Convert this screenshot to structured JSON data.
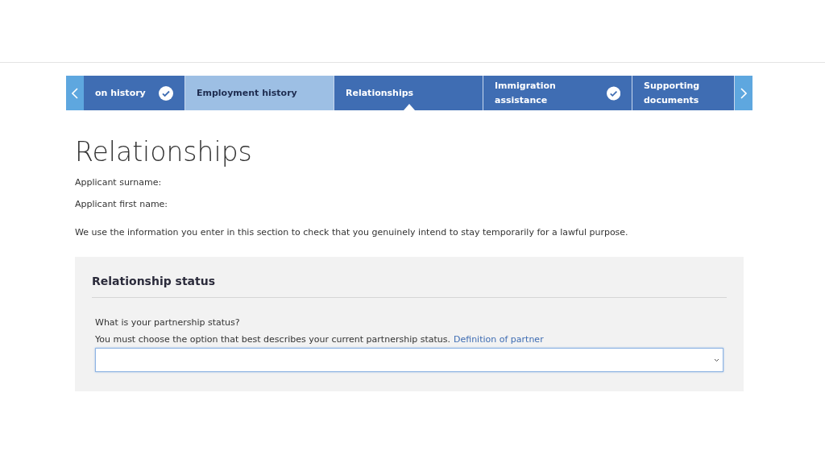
{
  "steps": [
    {
      "label": "on history",
      "completed": true,
      "highlighted": false,
      "selected": false
    },
    {
      "label": "Employment history",
      "completed": false,
      "highlighted": true,
      "selected": false
    },
    {
      "label": "Relationships",
      "completed": false,
      "highlighted": false,
      "selected": true
    },
    {
      "label": "Immigration assistance",
      "completed": true,
      "highlighted": false,
      "selected": false
    },
    {
      "label": "Supporting documents",
      "completed": false,
      "highlighted": false,
      "selected": false
    }
  ],
  "page_title": "Relationships",
  "applicant_fields": [
    "Applicant surname:",
    "Applicant first name:"
  ],
  "intro": "We use the information you enter in this section to check that you genuinely intend to stay temporarily for a lawful purpose.",
  "section": {
    "heading": "Relationship status",
    "question": "What is your partnership status?",
    "hint": "You must choose the option that best describes your current partnership status.",
    "link": "Definition of partner"
  }
}
